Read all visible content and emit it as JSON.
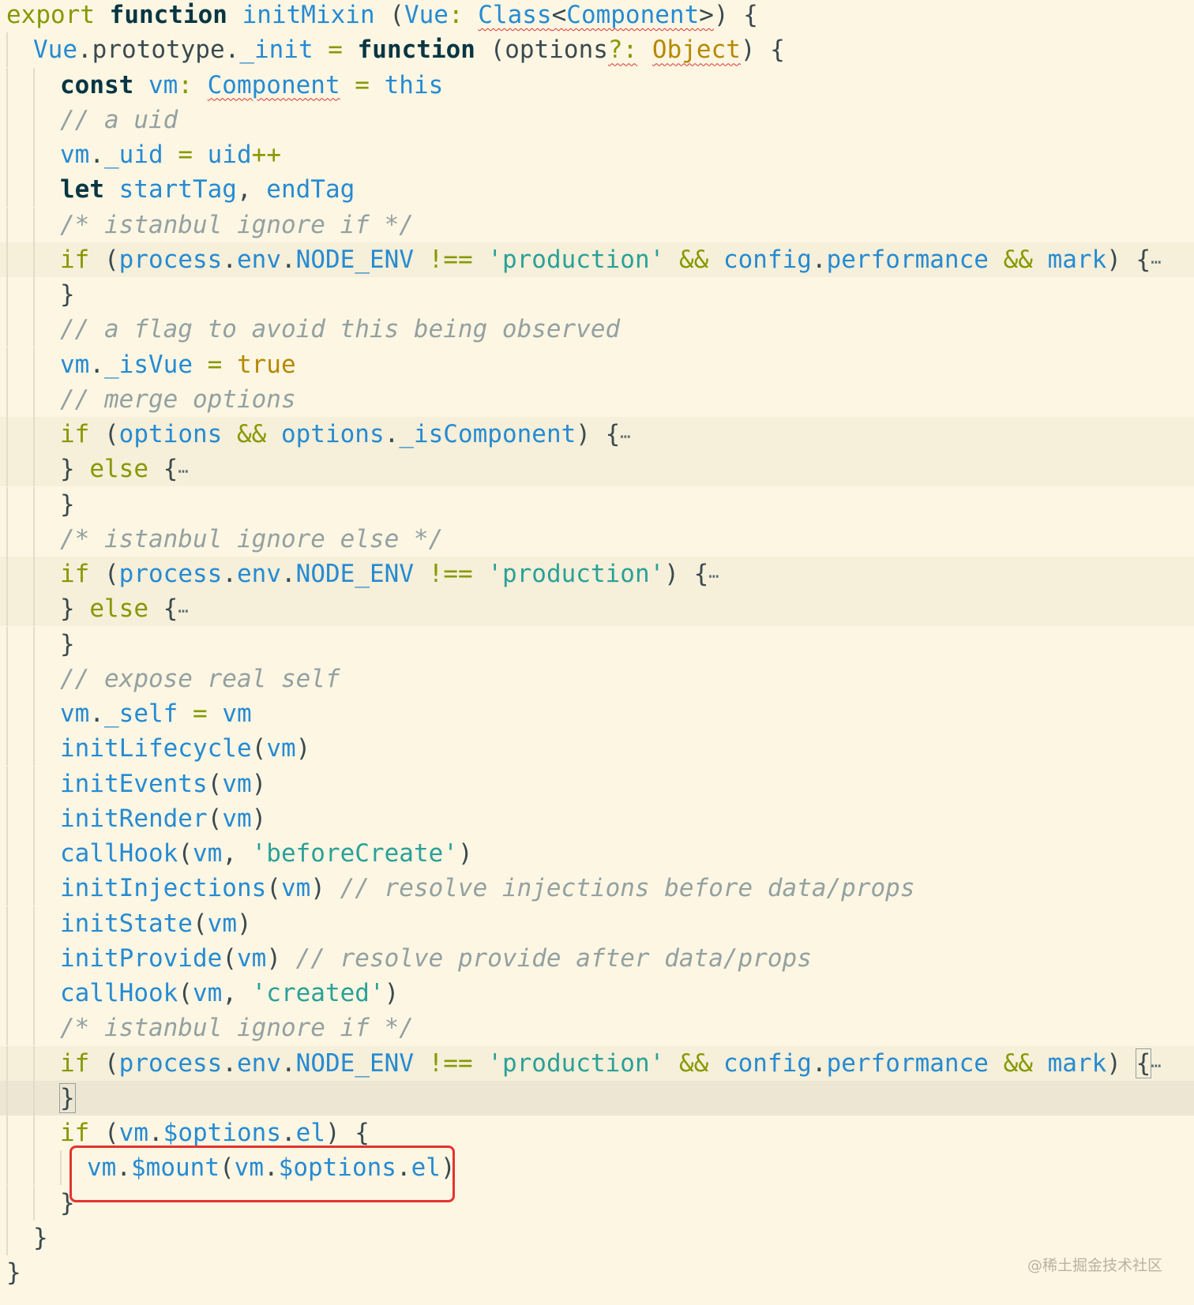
{
  "editor": {
    "lines": [
      {
        "tokens": [
          [
            "t-kw",
            "export "
          ],
          [
            "t-kw-bold",
            "function "
          ],
          [
            "t-fn",
            "initMixin "
          ],
          [
            "t-pl",
            "("
          ],
          [
            "t-id",
            "Vue"
          ],
          [
            "t-op",
            ": "
          ],
          [
            "t-ty squig",
            "Class"
          ],
          [
            "t-pl squig",
            "<"
          ],
          [
            "t-ty squig",
            "Component"
          ],
          [
            "t-pl squig",
            ">"
          ],
          [
            "t-pl",
            ") {"
          ]
        ]
      },
      {
        "tokens": [
          [
            "t-id",
            "Vue"
          ],
          [
            "t-pl",
            ".prototype."
          ],
          [
            "t-id",
            "_init "
          ],
          [
            "t-op",
            "= "
          ],
          [
            "t-kw-bold",
            "function "
          ],
          [
            "t-pl",
            "(options"
          ],
          [
            "t-op squig",
            "?:"
          ],
          [
            "t-pl",
            " "
          ],
          [
            "t-tyv squig",
            "Object"
          ],
          [
            "t-pl",
            ") {"
          ]
        ]
      },
      {
        "tokens": [
          [
            "t-kw-bold",
            "const "
          ],
          [
            "t-id",
            "vm"
          ],
          [
            "t-op",
            ": "
          ],
          [
            "t-ty squig",
            "Component"
          ],
          [
            "t-op",
            " = "
          ],
          [
            "t-id",
            "this"
          ]
        ]
      },
      {
        "tokens": [
          [
            "t-cm",
            "// a uid"
          ]
        ]
      },
      {
        "tokens": [
          [
            "t-id",
            "vm"
          ],
          [
            "t-pl",
            "."
          ],
          [
            "t-id",
            "_uid "
          ],
          [
            "t-op",
            "= "
          ],
          [
            "t-id",
            "uid"
          ],
          [
            "t-op",
            "++"
          ]
        ]
      },
      {
        "tokens": [
          [
            "t-kw-bold",
            "let "
          ],
          [
            "t-id",
            "startTag"
          ],
          [
            "t-pl",
            ", "
          ],
          [
            "t-id",
            "endTag"
          ]
        ]
      },
      {
        "tokens": [
          [
            "t-cm",
            "/* istanbul ignore if */"
          ]
        ]
      },
      {
        "tokens": [
          [
            "t-kw",
            "if "
          ],
          [
            "t-pl",
            "("
          ],
          [
            "t-id",
            "process"
          ],
          [
            "t-pl",
            "."
          ],
          [
            "t-id",
            "env"
          ],
          [
            "t-pl",
            "."
          ],
          [
            "t-id",
            "NODE_ENV "
          ],
          [
            "t-op",
            "!== "
          ],
          [
            "t-str",
            "'production' "
          ],
          [
            "t-op",
            "&& "
          ],
          [
            "t-id",
            "config"
          ],
          [
            "t-pl",
            "."
          ],
          [
            "t-id",
            "performance "
          ],
          [
            "t-op",
            "&& "
          ],
          [
            "t-id",
            "mark"
          ],
          [
            "t-pl",
            ") {"
          ],
          [
            "ell",
            "⋯"
          ]
        ]
      },
      {
        "tokens": [
          [
            "t-pl",
            "}"
          ]
        ]
      },
      {
        "tokens": [
          [
            "t-cm",
            "// a flag to avoid this being observed"
          ]
        ]
      },
      {
        "tokens": [
          [
            "t-id",
            "vm"
          ],
          [
            "t-pl",
            "."
          ],
          [
            "t-id",
            "_isVue "
          ],
          [
            "t-op",
            "= "
          ],
          [
            "t-val",
            "true"
          ]
        ]
      },
      {
        "tokens": [
          [
            "t-cm",
            "// merge options"
          ]
        ]
      },
      {
        "tokens": [
          [
            "t-kw",
            "if "
          ],
          [
            "t-pl",
            "("
          ],
          [
            "t-id",
            "options "
          ],
          [
            "t-op",
            "&& "
          ],
          [
            "t-id",
            "options"
          ],
          [
            "t-pl",
            "."
          ],
          [
            "t-id",
            "_isComponent"
          ],
          [
            "t-pl",
            ") {"
          ],
          [
            "ell",
            "⋯"
          ]
        ]
      },
      {
        "tokens": [
          [
            "t-pl",
            "} "
          ],
          [
            "t-kw",
            "else "
          ],
          [
            "t-pl",
            "{"
          ],
          [
            "ell",
            "⋯"
          ]
        ]
      },
      {
        "tokens": [
          [
            "t-pl",
            "}"
          ]
        ]
      },
      {
        "tokens": [
          [
            "t-cm",
            "/* istanbul ignore else */"
          ]
        ]
      },
      {
        "tokens": [
          [
            "t-kw",
            "if "
          ],
          [
            "t-pl",
            "("
          ],
          [
            "t-id",
            "process"
          ],
          [
            "t-pl",
            "."
          ],
          [
            "t-id",
            "env"
          ],
          [
            "t-pl",
            "."
          ],
          [
            "t-id",
            "NODE_ENV "
          ],
          [
            "t-op",
            "!== "
          ],
          [
            "t-str",
            "'production'"
          ],
          [
            "t-pl",
            ") {"
          ],
          [
            "ell",
            "⋯"
          ]
        ]
      },
      {
        "tokens": [
          [
            "t-pl",
            "} "
          ],
          [
            "t-kw",
            "else "
          ],
          [
            "t-pl",
            "{"
          ],
          [
            "ell",
            "⋯"
          ]
        ]
      },
      {
        "tokens": [
          [
            "t-pl",
            "}"
          ]
        ]
      },
      {
        "tokens": [
          [
            "t-cm",
            "// expose real self"
          ]
        ]
      },
      {
        "tokens": [
          [
            "t-id",
            "vm"
          ],
          [
            "t-pl",
            "."
          ],
          [
            "t-id",
            "_self "
          ],
          [
            "t-op",
            "= "
          ],
          [
            "t-id",
            "vm"
          ]
        ]
      },
      {
        "tokens": [
          [
            "t-fn",
            "initLifecycle"
          ],
          [
            "t-pl",
            "("
          ],
          [
            "t-id",
            "vm"
          ],
          [
            "t-pl",
            ")"
          ]
        ]
      },
      {
        "tokens": [
          [
            "t-fn",
            "initEvents"
          ],
          [
            "t-pl",
            "("
          ],
          [
            "t-id",
            "vm"
          ],
          [
            "t-pl",
            ")"
          ]
        ]
      },
      {
        "tokens": [
          [
            "t-fn",
            "initRender"
          ],
          [
            "t-pl",
            "("
          ],
          [
            "t-id",
            "vm"
          ],
          [
            "t-pl",
            ")"
          ]
        ]
      },
      {
        "tokens": [
          [
            "t-fn",
            "callHook"
          ],
          [
            "t-pl",
            "("
          ],
          [
            "t-id",
            "vm"
          ],
          [
            "t-pl",
            ", "
          ],
          [
            "t-str",
            "'beforeCreate'"
          ],
          [
            "t-pl",
            ")"
          ]
        ]
      },
      {
        "tokens": [
          [
            "t-fn",
            "initInjections"
          ],
          [
            "t-pl",
            "("
          ],
          [
            "t-id",
            "vm"
          ],
          [
            "t-pl",
            ") "
          ],
          [
            "t-cm",
            "// resolve injections before data/props"
          ]
        ]
      },
      {
        "tokens": [
          [
            "t-fn",
            "initState"
          ],
          [
            "t-pl",
            "("
          ],
          [
            "t-id",
            "vm"
          ],
          [
            "t-pl",
            ")"
          ]
        ]
      },
      {
        "tokens": [
          [
            "t-fn",
            "initProvide"
          ],
          [
            "t-pl",
            "("
          ],
          [
            "t-id",
            "vm"
          ],
          [
            "t-pl",
            ") "
          ],
          [
            "t-cm",
            "// resolve provide after data/props"
          ]
        ]
      },
      {
        "tokens": [
          [
            "t-fn",
            "callHook"
          ],
          [
            "t-pl",
            "("
          ],
          [
            "t-id",
            "vm"
          ],
          [
            "t-pl",
            ", "
          ],
          [
            "t-str",
            "'created'"
          ],
          [
            "t-pl",
            ")"
          ]
        ]
      },
      {
        "tokens": [
          [
            "t-cm",
            "/* istanbul ignore if */"
          ]
        ]
      },
      {
        "tokens": [
          [
            "t-kw",
            "if "
          ],
          [
            "t-pl",
            "("
          ],
          [
            "t-id",
            "process"
          ],
          [
            "t-pl",
            "."
          ],
          [
            "t-id",
            "env"
          ],
          [
            "t-pl",
            "."
          ],
          [
            "t-id",
            "NODE_ENV "
          ],
          [
            "t-op",
            "!== "
          ],
          [
            "t-str",
            "'production' "
          ],
          [
            "t-op",
            "&& "
          ],
          [
            "t-id",
            "config"
          ],
          [
            "t-pl",
            "."
          ],
          [
            "t-id",
            "performance "
          ],
          [
            "t-op",
            "&& "
          ],
          [
            "t-id",
            "mark"
          ],
          [
            "t-pl",
            ") "
          ],
          [
            "t-pl bracket-hl",
            "{"
          ],
          [
            "ell",
            "⋯"
          ]
        ]
      },
      {
        "tokens": [
          [
            "t-pl bracket-hl",
            "}"
          ]
        ]
      },
      {
        "tokens": [
          [
            "t-kw",
            "if "
          ],
          [
            "t-pl",
            "("
          ],
          [
            "t-id",
            "vm"
          ],
          [
            "t-pl",
            "."
          ],
          [
            "t-id",
            "$options"
          ],
          [
            "t-pl",
            "."
          ],
          [
            "t-id",
            "el"
          ],
          [
            "t-pl",
            ") {"
          ]
        ]
      },
      {
        "tokens": [
          [
            "t-id",
            "vm"
          ],
          [
            "t-pl",
            "."
          ],
          [
            "t-fn",
            "$mount"
          ],
          [
            "t-pl",
            "("
          ],
          [
            "t-id",
            "vm"
          ],
          [
            "t-pl",
            "."
          ],
          [
            "t-id",
            "$options"
          ],
          [
            "t-pl",
            "."
          ],
          [
            "t-id",
            "el"
          ],
          [
            "t-pl",
            ")"
          ]
        ]
      },
      {
        "tokens": [
          [
            "t-pl",
            "}"
          ]
        ]
      },
      {
        "tokens": [
          [
            "t-pl",
            "}"
          ]
        ]
      },
      {
        "tokens": [
          [
            "t-pl",
            "}"
          ]
        ]
      }
    ]
  },
  "watermark": "@稀土掘金技术社区"
}
